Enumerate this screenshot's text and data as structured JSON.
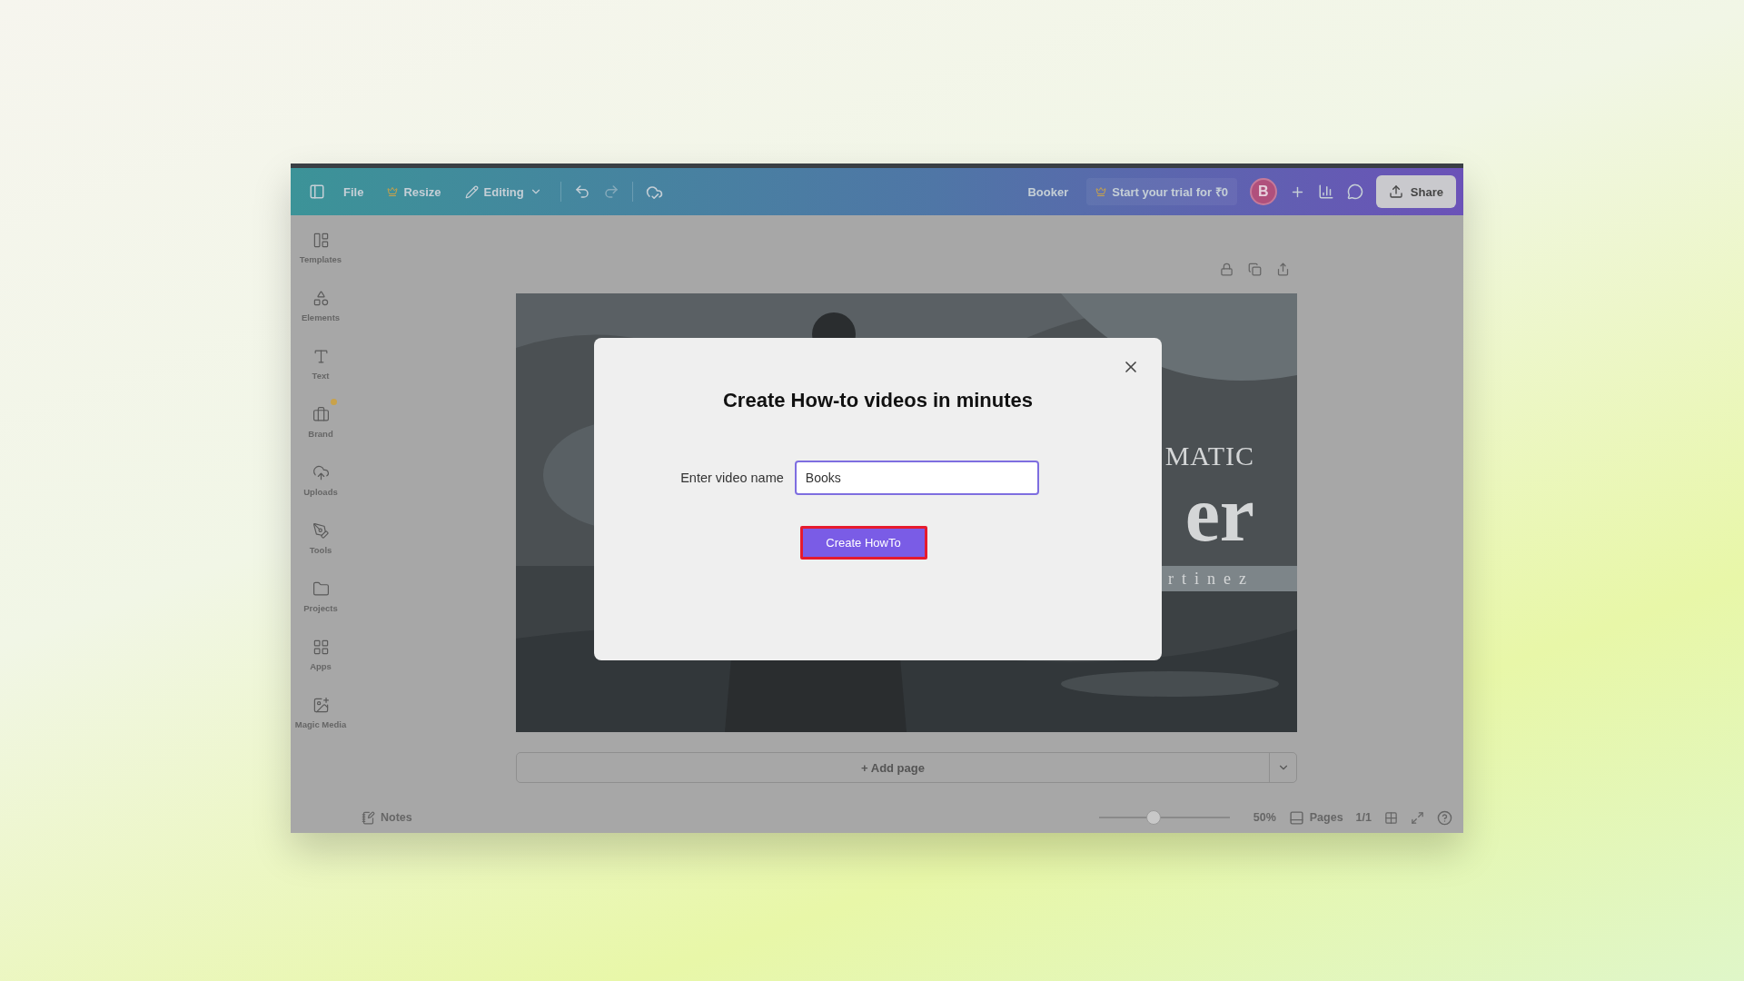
{
  "topbar": {
    "file": "File",
    "resize": "Resize",
    "mode": "Editing",
    "title": "Booker",
    "trial": "Start your trial for ₹0",
    "avatar": "B",
    "share": "Share"
  },
  "sidebar": {
    "items": [
      {
        "label": "Templates",
        "badge": false
      },
      {
        "label": "Elements",
        "badge": false
      },
      {
        "label": "Text",
        "badge": false
      },
      {
        "label": "Brand",
        "badge": true
      },
      {
        "label": "Uploads",
        "badge": false
      },
      {
        "label": "Tools",
        "badge": false
      },
      {
        "label": "Projects",
        "badge": false
      },
      {
        "label": "Apps",
        "badge": false
      },
      {
        "label": "Magic Media",
        "badge": false
      }
    ]
  },
  "canvas": {
    "kind": "picture",
    "texts": [
      "MATIC",
      "er",
      "rtinez"
    ]
  },
  "add_page": "+ Add page",
  "footer": {
    "notes": "Notes",
    "zoom": {
      "level": 0.42,
      "reading": "50%"
    },
    "pages": "Pages",
    "page_count": "1/1"
  },
  "dialog": {
    "title": "Create How-to videos in minutes",
    "field_label": "Enter video name",
    "field_value": "Books",
    "button": "Create HowTo",
    "highlighted": true
  }
}
